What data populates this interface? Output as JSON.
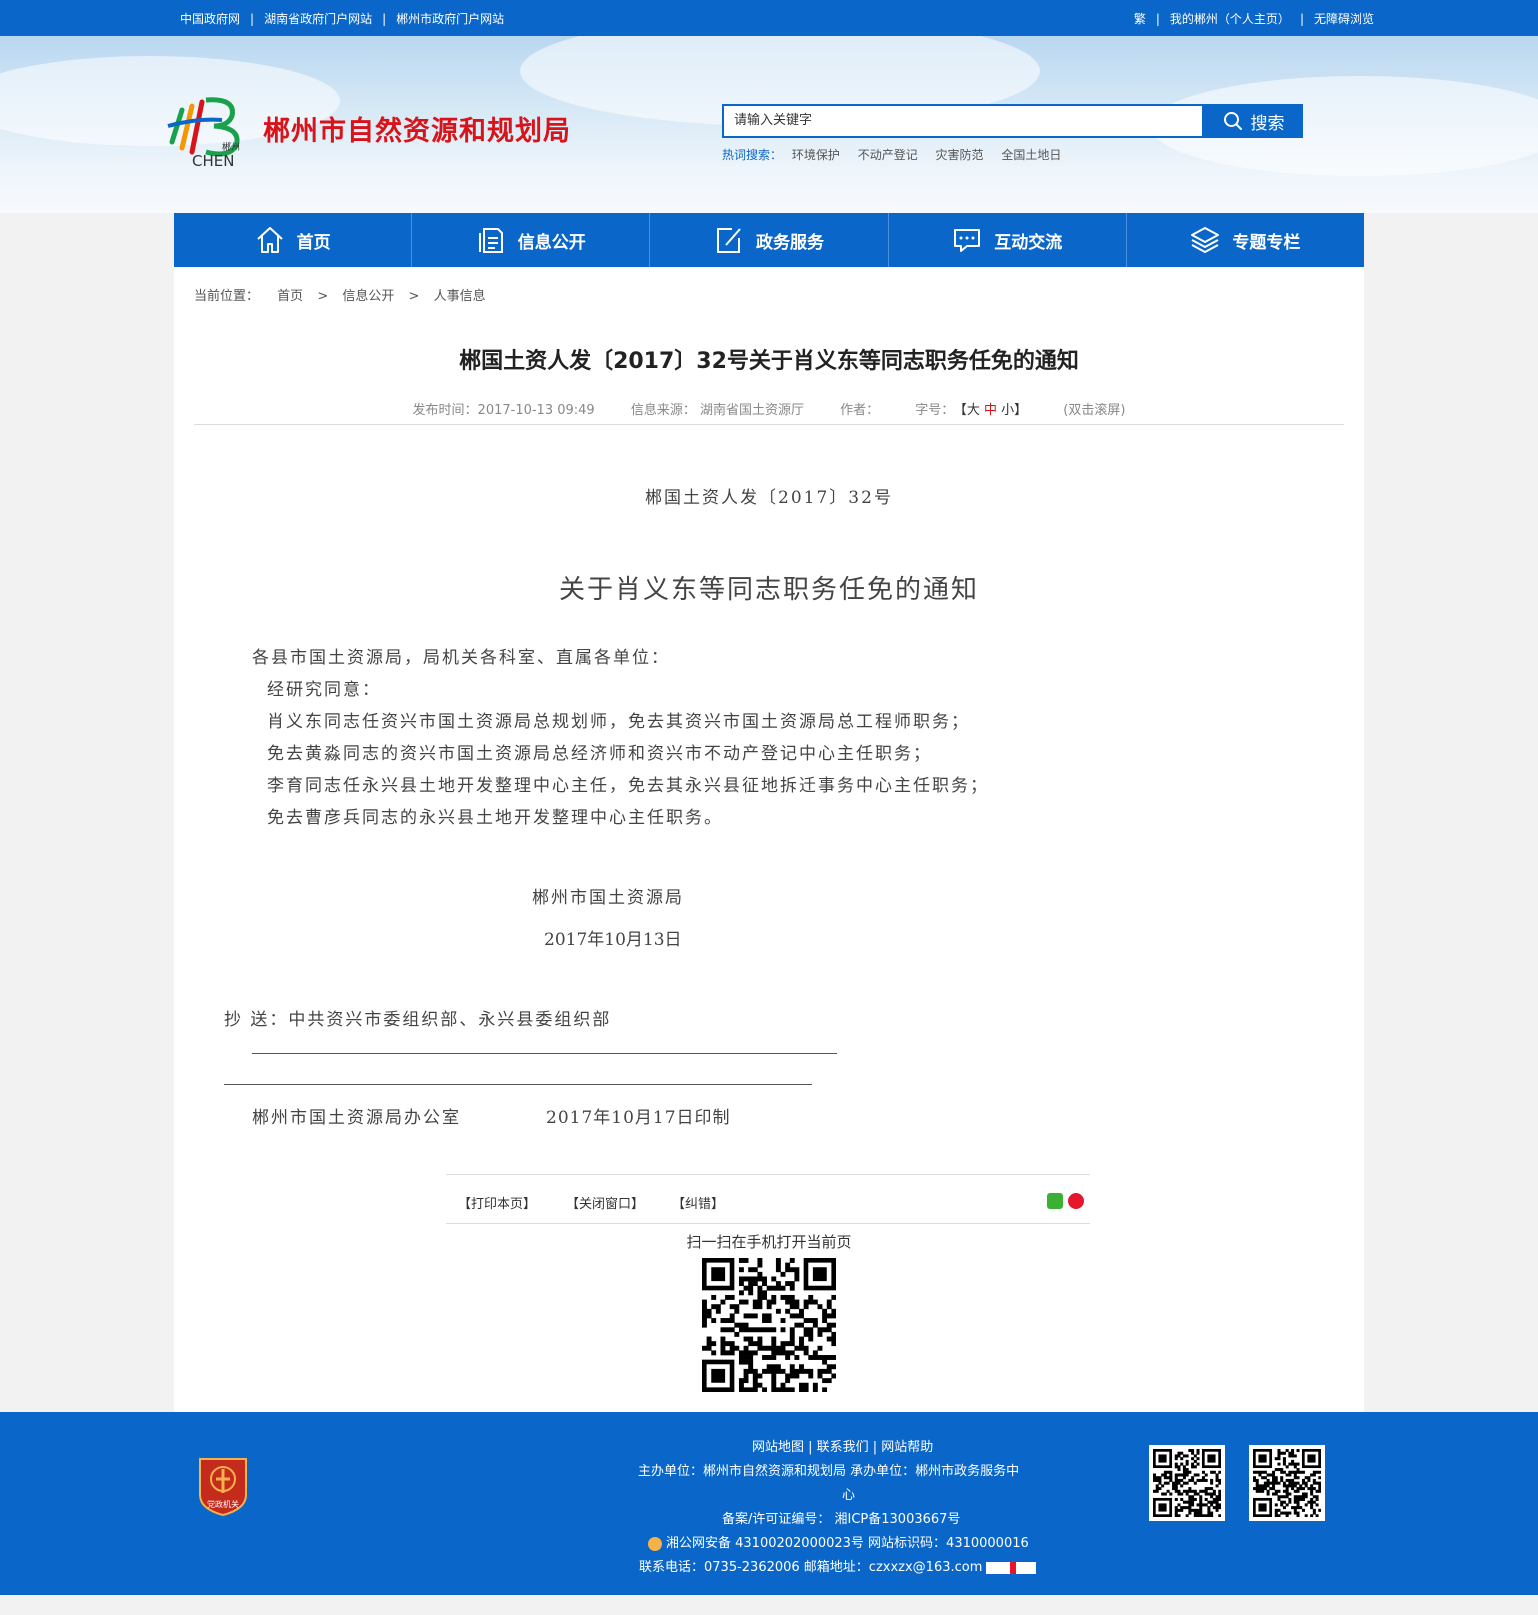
{
  "topbar": {
    "links_left": [
      "中国政府网",
      "湖南省政府门户网站",
      "郴州市政府门户网站"
    ],
    "links_right": [
      "繁",
      "我的郴州（个人主页）",
      "无障碍浏览"
    ]
  },
  "header": {
    "logo_text_cn": "郴州",
    "logo_text_en": "CHEN",
    "site_title": "郴州市自然资源和规划局",
    "search_placeholder": "请输入关键字",
    "search_button": "搜索",
    "hotwords_label": "热词搜索：",
    "hotwords": [
      "环境保护",
      "不动产登记",
      "灾害防范",
      "全国土地日"
    ]
  },
  "nav": [
    {
      "label": "首页",
      "icon": "home-icon"
    },
    {
      "label": "信息公开",
      "icon": "document-icon"
    },
    {
      "label": "政务服务",
      "icon": "edit-icon"
    },
    {
      "label": "互动交流",
      "icon": "chat-icon"
    },
    {
      "label": "专题专栏",
      "icon": "layers-icon"
    }
  ],
  "breadcrumb": {
    "prefix": "当前位置：",
    "items": [
      "首页",
      "信息公开",
      "人事信息"
    ],
    "sep": ">"
  },
  "article": {
    "title": "郴国土资人发〔2017〕32号关于肖义东等同志职务任免的通知",
    "meta": {
      "publish": "发布时间：2017-10-13 09:49",
      "source": "信息来源：  湖南省国土资源厅",
      "author": "作者：",
      "font_label": "字号：",
      "font_open": "【",
      "font_large": "大",
      "font_medium": "中",
      "font_small": "小",
      "font_close": "】",
      "scroll": "(双击滚屏)"
    },
    "doc_number": "郴国土资人发〔2017〕32号",
    "doc_title": "关于肖义东等同志职务任免的通知",
    "paragraphs": [
      "各县市国土资源局，局机关各科室、直属各单位：",
      "经研究同意：",
      "肖义东同志任资兴市国土资源局总规划师，免去其资兴市国土资源局总工程师职务；",
      "免去黄淼同志的资兴市国土资源局总经济师和资兴市不动产登记中心主任职务；",
      "李育同志任永兴县土地开发整理中心主任，免去其永兴县征地拆迁事务中心主任职务；",
      "免去曹彦兵同志的永兴县土地开发整理中心主任职务。"
    ],
    "signature_org": "郴州市国土资源局",
    "signature_date": "2017年10月13日",
    "cc": "抄  送：中共资兴市委组织部、永兴县委组织部",
    "print_org": "郴州市国土资源局办公室",
    "print_date": "2017年10月17日印制"
  },
  "tools": {
    "print": "【打印本页】",
    "close": "【关闭窗口】",
    "error": "【纠错】",
    "qr_caption": "扫一扫在手机打开当前页"
  },
  "footer": {
    "badge_text": "党政机关",
    "links": "网站地图 | 联系我们 | 网站帮助",
    "host": "主办单位：郴州市自然资源和规划局    承办单位：郴州市政务服务中",
    "host_wrap": "心",
    "icp": "备案/许可证编号：  湘ICP备13003667号",
    "police": "湘公网安备 43100202000023号     网站标识码：4310000016",
    "contact": "联系电话：0735-2362006     邮箱地址：czxxzx@163.com"
  },
  "colors": {
    "primary": "#0a66c8",
    "title_red": "#d7141a"
  }
}
